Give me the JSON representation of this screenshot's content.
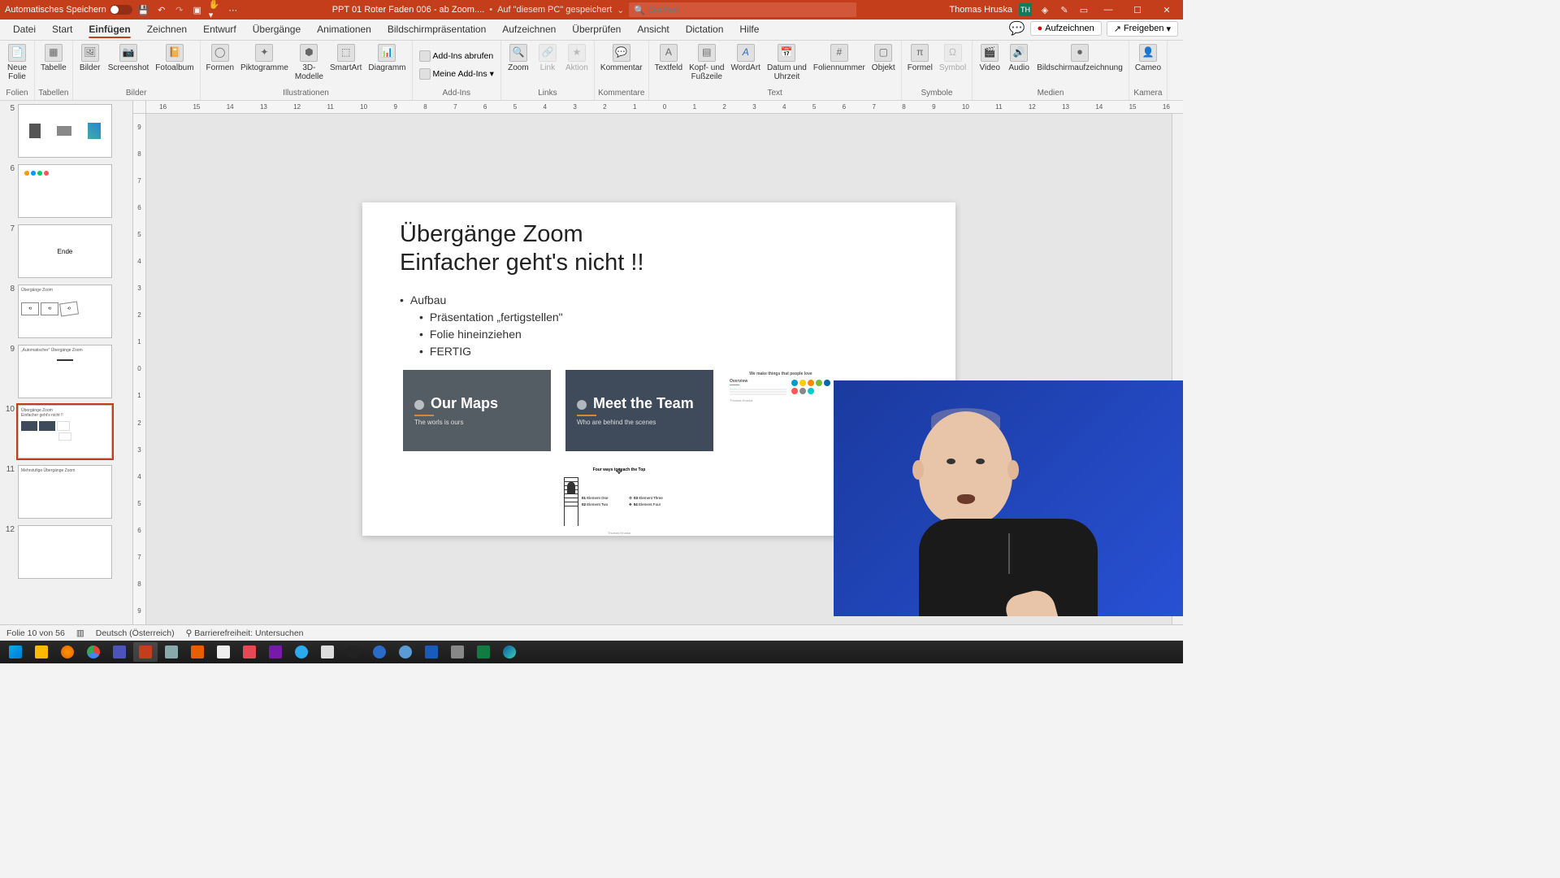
{
  "titlebar": {
    "autosave": "Automatisches Speichern",
    "filename": "PPT 01 Roter Faden 006 - ab Zoom....",
    "save_location": "Auf \"diesem PC\" gespeichert",
    "search_placeholder": "Suchen",
    "username": "Thomas Hruska",
    "user_initials": "TH"
  },
  "tabs": {
    "datei": "Datei",
    "start": "Start",
    "einfuegen": "Einfügen",
    "zeichnen": "Zeichnen",
    "entwurf": "Entwurf",
    "uebergaenge": "Übergänge",
    "animationen": "Animationen",
    "bildschirm": "Bildschirmpräsentation",
    "aufzeichnen": "Aufzeichnen",
    "ueberpruefen": "Überprüfen",
    "ansicht": "Ansicht",
    "dictation": "Dictation",
    "hilfe": "Hilfe",
    "record": "Aufzeichnen",
    "share": "Freigeben"
  },
  "ribbon": {
    "groups": {
      "folien": "Folien",
      "tabellen": "Tabellen",
      "bilder": "Bilder",
      "illustrationen": "Illustrationen",
      "addins": "Add-Ins",
      "links": "Links",
      "kommentare": "Kommentare",
      "text": "Text",
      "symbole": "Symbole",
      "medien": "Medien",
      "kamera": "Kamera"
    },
    "buttons": {
      "neue_folie": "Neue\nFolie",
      "tabelle": "Tabelle",
      "bilder": "Bilder",
      "screenshot": "Screenshot",
      "fotoalbum": "Fotoalbum",
      "formen": "Formen",
      "piktogramme": "Piktogramme",
      "3dmodelle": "3D-\nModelle",
      "smartart": "SmartArt",
      "diagramm": "Diagramm",
      "addins_abrufen": "Add-Ins abrufen",
      "meine_addins": "Meine Add-Ins",
      "zoom": "Zoom",
      "link": "Link",
      "aktion": "Aktion",
      "kommentar": "Kommentar",
      "textfeld": "Textfeld",
      "kopf_fusszeile": "Kopf- und\nFußzeile",
      "wordart": "WordArt",
      "datum_uhrzeit": "Datum und\nUhrzeit",
      "foliennummer": "Foliennummer",
      "objekt": "Objekt",
      "formel": "Formel",
      "symbol": "Symbol",
      "video": "Video",
      "audio": "Audio",
      "bildschirmaufz": "Bildschirmaufzeichnung",
      "cameo": "Cameo"
    }
  },
  "thumbnails": {
    "5": "5",
    "6": "6",
    "7": "7",
    "8": "8",
    "9": "9",
    "10": "10",
    "11": "11",
    "12": "12",
    "ende": "Ende",
    "t8_title": "Übergänge Zoom",
    "t9_title": "„Automatischer\" Übergänge Zoom",
    "t10_title": "Übergänge Zoom\nEinfacher geht's nicht !!",
    "t11_title": "Mehrstufige Übergänge Zoom"
  },
  "slide": {
    "title_line1": "Übergänge Zoom",
    "title_line2": "Einfacher geht's nicht !!",
    "bullet1": "Aufbau",
    "bullet2": "Präsentation „fertigstellen\"",
    "bullet3": "Folie hineinziehen",
    "bullet4": "FERTIG",
    "card1_title": "Our Maps",
    "card1_sub": "The worls is ours",
    "card2_title": "Meet the Team",
    "card2_sub": "Who are behind the scenes",
    "mini3_title": "We make things that people love",
    "mini3_text": "Overview",
    "mini3_footer": "Thomas Hruska",
    "mini4_title": "Four ways to reach the Top",
    "mini4_r1": "Element One",
    "mini4_r2": "Element Two",
    "mini4_r3": "Element Three",
    "mini4_r4": "Element Four",
    "mini4_n1": "01",
    "mini4_n2": "02",
    "mini4_n3": "03",
    "mini4_n4": "04",
    "mini4_footer": "Thomas Hruska"
  },
  "ruler": {
    "marks": [
      "16",
      "15",
      "14",
      "13",
      "12",
      "11",
      "10",
      "9",
      "8",
      "7",
      "6",
      "5",
      "4",
      "3",
      "2",
      "1",
      "0",
      "1",
      "2",
      "3",
      "4",
      "5",
      "6",
      "7",
      "8",
      "9",
      "10",
      "11",
      "12",
      "13",
      "14",
      "15",
      "16"
    ],
    "vmarks": [
      "9",
      "8",
      "7",
      "6",
      "5",
      "4",
      "3",
      "2",
      "1",
      "0",
      "1",
      "2",
      "3",
      "4",
      "5",
      "6",
      "7",
      "8",
      "9"
    ]
  },
  "statusbar": {
    "slide_info": "Folie 10 von 56",
    "language": "Deutsch (Österreich)",
    "accessibility": "Barrierefreiheit: Untersuchen"
  }
}
